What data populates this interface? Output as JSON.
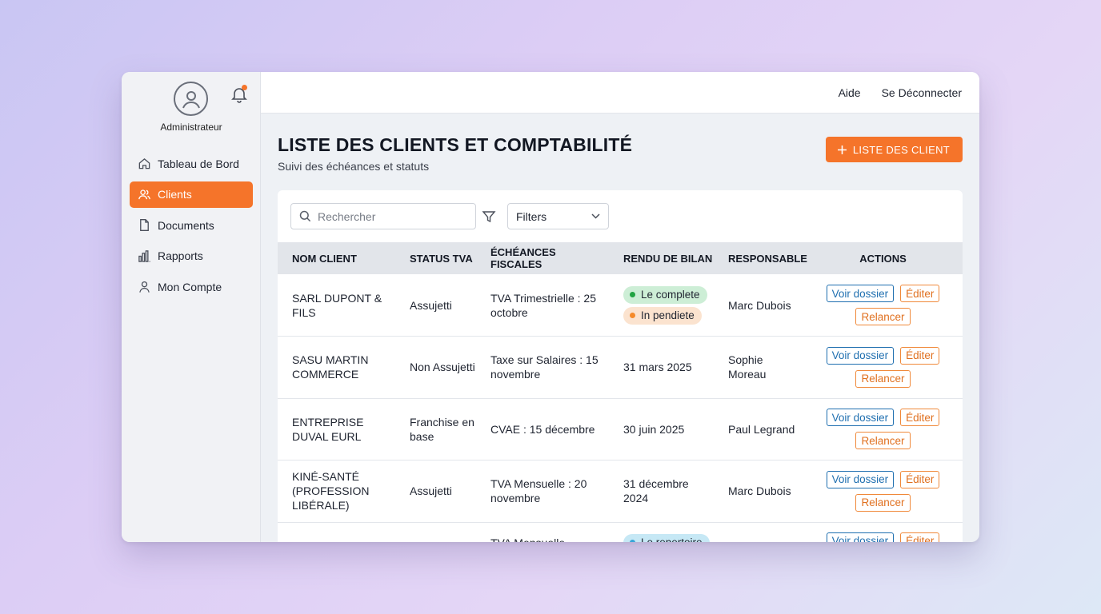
{
  "sidebar": {
    "user_label": "Administrateur",
    "items": [
      {
        "label": "Tableau de Bord",
        "icon": "home-icon"
      },
      {
        "label": "Clients",
        "icon": "users-icon"
      },
      {
        "label": "Documents",
        "icon": "document-icon"
      },
      {
        "label": "Rapports",
        "icon": "bar-chart-icon"
      },
      {
        "label": "Mon Compte",
        "icon": "user-icon"
      }
    ],
    "active_item": "Clients"
  },
  "topbar": {
    "help_label": "Aide",
    "logout_label": "Se Déconnecter"
  },
  "header": {
    "title": "LISTE DES CLIENTS ET COMPTABILITÉ",
    "subtitle": "Suivi des échéances et statuts",
    "add_button_label": "LISTE DES CLIENT"
  },
  "toolbar": {
    "search_placeholder": "Rechercher",
    "filters_label": "Filters"
  },
  "table": {
    "columns": [
      "NOM CLIENT",
      "STATUS TVA",
      "ÉCHÉANCES FISCALES",
      "RENDU DE BILAN",
      "RESPONSABLE",
      "ACTIONS"
    ],
    "rows": [
      {
        "client": "SARL DUPONT & FILS",
        "tva": "Assujetti",
        "echeance": "TVA Trimestrielle : 25 octobre",
        "bilan_badges": [
          "Le complete",
          "In pendiete"
        ],
        "responsable": "Marc Dubois"
      },
      {
        "client": "SASU MARTIN COMMERCE",
        "tva": "Non Assujetti",
        "echeance": "Taxe sur Salaires : 15 novembre",
        "bilan": "31 mars 2025",
        "responsable": "Sophie Moreau"
      },
      {
        "client": "ENTREPRISE DUVAL EURL",
        "tva": "Franchise en base",
        "echeance": "CVAE : 15 décembre",
        "bilan": "30 juin 2025",
        "responsable": "Paul Legrand"
      },
      {
        "client": "KINÉ-SANTÉ (PROFESSION LIBÉRALE)",
        "tva": "Assujetti",
        "echeance": "TVA Mensuelle : 20 novembre",
        "bilan": "31 décembre 2024",
        "responsable": "Marc Dubois"
      },
      {
        "client": "",
        "tva": "",
        "echeance": "TVA Mensuelle",
        "bilan_badges": [
          "Le repertoire"
        ],
        "responsable": ""
      }
    ],
    "action_labels": {
      "view": "Voir dossier",
      "edit": "Éditer",
      "remind": "Relancer"
    }
  },
  "colors": {
    "accent": "#f5742a",
    "link_blue": "#1f6fb0"
  }
}
